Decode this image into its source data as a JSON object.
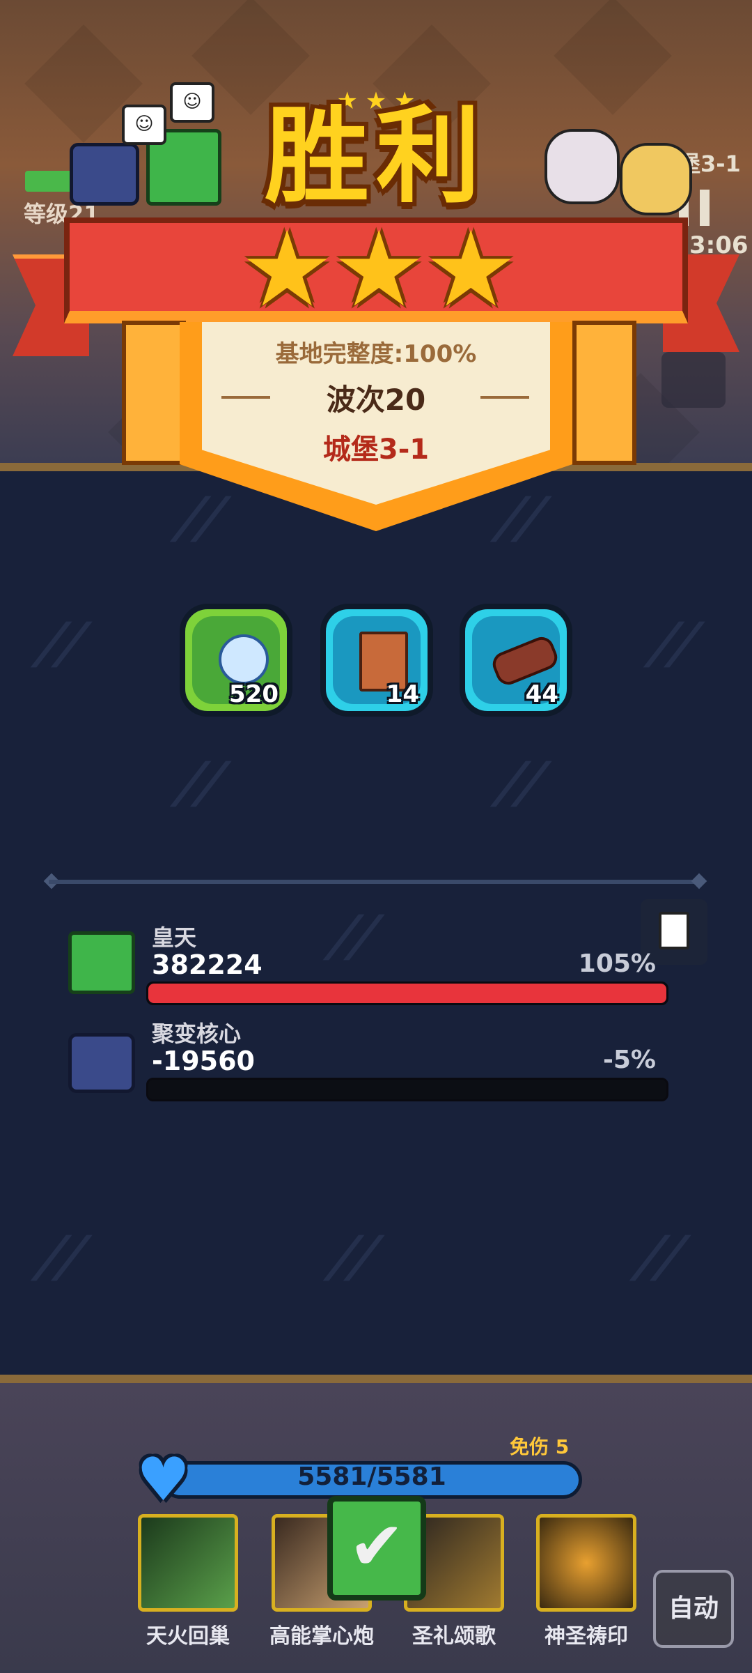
{
  "victory": {
    "title": "胜利",
    "stars": 3,
    "integrity": "基地完整度:100%",
    "wave": "波次20",
    "stage": "城堡3-1"
  },
  "background_hud": {
    "level_label": "等级21",
    "stage_label": "堡3-1",
    "timer": "3:06"
  },
  "rewards": [
    {
      "icon": "crystal-orb-icon",
      "count": "520",
      "frame_color": "#7ed23a"
    },
    {
      "icon": "book-icon",
      "count": "14",
      "frame_color": "#2ed0e8"
    },
    {
      "icon": "wood-log-icon",
      "count": "44",
      "frame_color": "#2ed0e8"
    }
  ],
  "damage_stats": [
    {
      "name": "皇天",
      "value": "382224",
      "percent": "105%",
      "fill": 1.0,
      "color": "#e8343c"
    },
    {
      "name": "聚变核心",
      "value": "-19560",
      "percent": "-5%",
      "fill": 0.0,
      "color": "#e8343c"
    }
  ],
  "bottom_bar": {
    "damage_reduction": "免伤 5",
    "hp": "5581/5581",
    "hp_fraction": 1.0,
    "skills": [
      "天火回巢",
      "高能掌心炮",
      "圣礼颂歌",
      "神圣祷印"
    ],
    "auto_label": "自动"
  },
  "colors": {
    "panel_bg": "#18213a",
    "gold": "#ffd21f",
    "ribbon_red": "#e8453b",
    "hp_blue": "#2a80d8"
  }
}
